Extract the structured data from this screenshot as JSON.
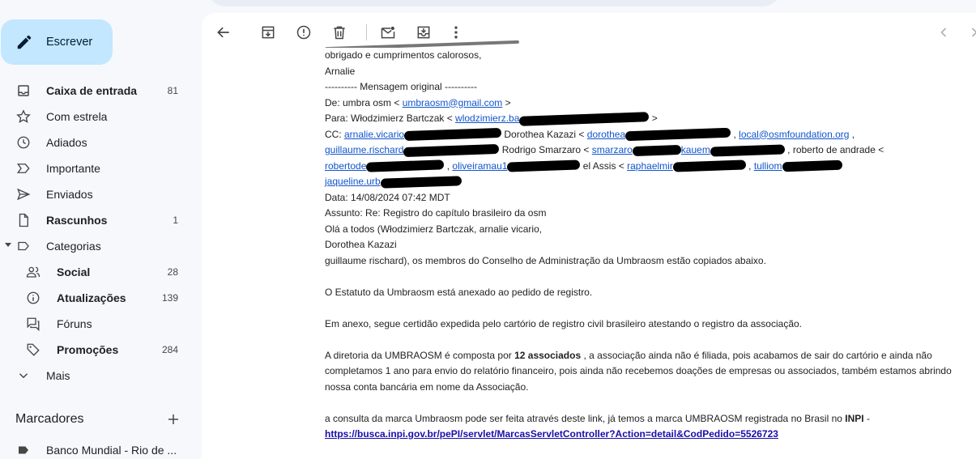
{
  "compose": {
    "label": "Escrever",
    "icon": "pencil-icon"
  },
  "nav": [
    {
      "label": "Caixa de entrada",
      "count": "81",
      "icon": "inbox-icon",
      "bold": true
    },
    {
      "label": "Com estrela",
      "count": "",
      "icon": "star-icon",
      "bold": false
    },
    {
      "label": "Adiados",
      "count": "",
      "icon": "clock-icon",
      "bold": false
    },
    {
      "label": "Importante",
      "count": "",
      "icon": "important-icon",
      "bold": false
    },
    {
      "label": "Enviados",
      "count": "",
      "icon": "send-icon",
      "bold": false
    },
    {
      "label": "Rascunhos",
      "count": "1",
      "icon": "draft-icon",
      "bold": true
    },
    {
      "label": "Categorias",
      "count": "",
      "icon": "label-icon",
      "bold": false
    },
    {
      "label": "Social",
      "count": "28",
      "icon": "people-icon",
      "bold": true
    },
    {
      "label": "Atualizações",
      "count": "139",
      "icon": "info-icon",
      "bold": true
    },
    {
      "label": "Fóruns",
      "count": "",
      "icon": "forum-icon",
      "bold": false
    },
    {
      "label": "Promoções",
      "count": "284",
      "icon": "tag-icon",
      "bold": true
    },
    {
      "label": "Mais",
      "count": "",
      "icon": "chevron-down-icon",
      "bold": false
    }
  ],
  "markers": {
    "title": "Marcadores",
    "items": [
      {
        "label": "Banco Mundial - Rio de ..."
      }
    ]
  },
  "toolbar": [
    "back-arrow-icon",
    "archive-icon",
    "report-spam-icon",
    "delete-icon",
    "mark-unread-icon",
    "move-to-icon",
    "more-vert-icon",
    "chevron-left-icon",
    "chevron-right-icon"
  ],
  "email": {
    "l1": "obrigado e cumprimentos calorosos,",
    "l2": "Arnalie",
    "l3": "---------- Mensagem original ----------",
    "from_prefix": "De: umbra osm < ",
    "from_email": "umbraosm@gmail.com",
    "from_suffix": " >",
    "to_prefix": "Para: Włodzimierz Bartczak < ",
    "to_email": "wlodzimierz.ba",
    "to_suffix": " >",
    "cc_prefix": "CC: ",
    "cc_1": "arnalie.vicario",
    "cc_2": " Dorothea Kazazi < ",
    "cc_3": "dorothea",
    "cc_4": "local@osmfoundation.org",
    "cc_5": " ,",
    "cc_6": "guillaume.rischard",
    "cc_7": " Rodrigo Smarzaro < ",
    "cc_8": "smarzaro",
    "cc_9": "kauem",
    "cc_10": " , roberto de andrade <",
    "cc_11": "robertode",
    "cc_12": "oliveiramau1",
    "cc_13": " el Assis < ",
    "cc_14": "raphaelmir",
    "cc_15": "tulliom",
    "cc_16": "jaqueline.urb",
    "date": "Data: 14/08/2024 07:42 MDT",
    "subject": "Assunto: Re: Registro do capítulo brasileiro da osm",
    "b1": "Olá a todos (Włodzimierz Bartczak, arnalie vicario,",
    "b2": "Dorothea Kazazi",
    "b3": "guillaume rischard), os membros do Conselho de Administração da Umbraosm estão copiados abaixo.",
    "b4": "O Estatuto da Umbraosm está anexado ao pedido de registro.",
    "b5": "Em anexo, segue certidão expedida pelo cartório de registro civil brasileiro atestando o registro da associação.",
    "b6_prefix": "A diretoria da UMBRAOSM é composta por ",
    "b6_bold": "12 associados",
    "b6_suffix": " , a associação ainda não é filiada, pois acabamos de sair do cartório e ainda não completamos 1 ano para envio do relatório financeiro, pois ainda não recebemos doações de empresas ou associados, também estamos abrindo nossa conta bancária em nome da Associação.",
    "b7_prefix": "a consulta da marca Umbraosm pode ser feita através deste link, já temos a marca UMBRAOSM registrada no Brasil no ",
    "b7_bold": "INPI",
    "b7_suffix": " -",
    "b7_link": "https://busca.inpi.gov.br/pePI/servlet/MarcasServletController?Action=detail&CodPedido=5526723"
  }
}
